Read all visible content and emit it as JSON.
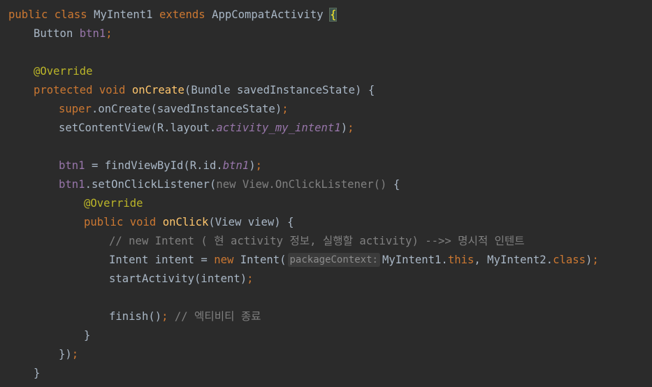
{
  "editor": {
    "language": "java",
    "theme": "darcula",
    "lines": [
      {
        "tokens": [
          "public",
          "class",
          "MyIntent1",
          "extends",
          "AppCompatActivity",
          "{"
        ]
      },
      {
        "tokens": [
          "Button",
          "btn1",
          ";"
        ]
      },
      {
        "tokens": []
      },
      {
        "tokens": [
          "@Override"
        ]
      },
      {
        "tokens": [
          "protected",
          "void",
          "onCreate",
          "(Bundle savedInstanceState) {"
        ]
      },
      {
        "tokens": [
          "super",
          ".onCreate(savedInstanceState)",
          ";"
        ]
      },
      {
        "tokens": [
          "setContentView(R.layout.",
          "activity_my_intent1",
          ")",
          ";"
        ]
      },
      {
        "tokens": []
      },
      {
        "tokens": [
          "btn1",
          " = findViewById(R.id.",
          "btn1",
          ")",
          ";"
        ]
      },
      {
        "tokens": [
          "btn1",
          ".setOnClickListener(",
          "new View.OnClickListener()",
          " {"
        ]
      },
      {
        "tokens": [
          "@Override"
        ]
      },
      {
        "tokens": [
          "public",
          "void",
          "onClick",
          "(View view) {"
        ]
      },
      {
        "tokens": [
          "// new Intent ( 현 activity 정보, 실행할 activity) -->> 명시적 인텐트"
        ]
      },
      {
        "tokens": [
          "Intent intent = ",
          "new",
          " Intent(",
          "packageContext:",
          "MyIntent1.",
          "this",
          ", MyIntent2.",
          "class",
          ")",
          ";"
        ]
      },
      {
        "tokens": [
          "startActivity(intent)",
          ";"
        ]
      },
      {
        "tokens": []
      },
      {
        "tokens": [
          "finish()",
          ";",
          "// 엑티비티 종료"
        ]
      },
      {
        "tokens": [
          "}"
        ]
      },
      {
        "tokens": [
          "})",
          ";"
        ]
      },
      {
        "tokens": [
          "}"
        ]
      }
    ]
  },
  "colors": {
    "background": "#2b2b2b",
    "keyword": "#cc7832",
    "annotation": "#bbb529",
    "method_declaration": "#ffc66d",
    "field": "#9876aa",
    "comment": "#808080",
    "plain": "#a9b7c6"
  }
}
